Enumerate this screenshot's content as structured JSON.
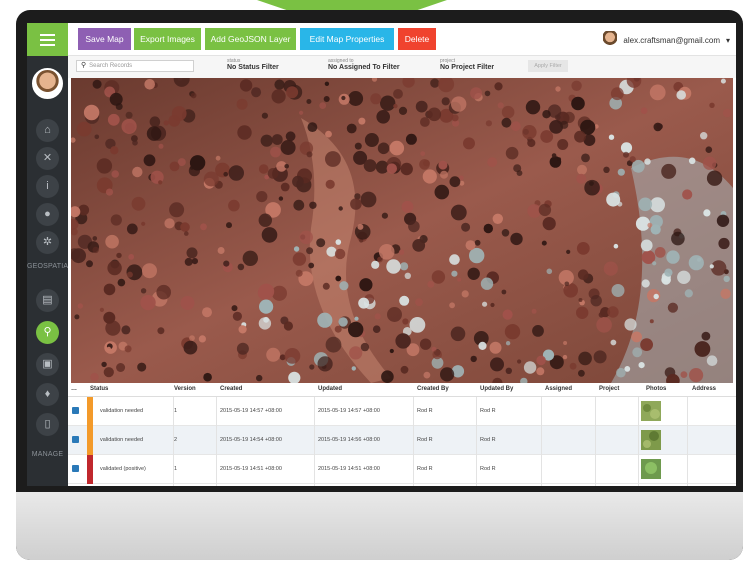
{
  "toolbar": {
    "buttons": [
      {
        "label": "Save Map",
        "color": "#8e5fb3"
      },
      {
        "label": "Export Images",
        "color": "#7ac143"
      },
      {
        "label": "Add GeoJSON Layer",
        "color": "#7ac143"
      },
      {
        "label": "Edit Map Properties",
        "color": "#29b6e8"
      },
      {
        "label": "Delete",
        "color": "#f0432e"
      }
    ],
    "user_email": "alex.craftsman@gmail.com"
  },
  "sidebar": {
    "section_geospatial": "GEOSPATIAL",
    "section_manage": "MANAGE",
    "icons": [
      "home-icon",
      "tools-icon",
      "info-icon",
      "tags-icon",
      "settings-icon",
      "document-icon",
      "map-pin-icon",
      "image-icon",
      "thumbs-up-icon",
      "file-icon"
    ]
  },
  "filters": {
    "search_placeholder": "Search Records",
    "status_label": "status",
    "status_value": "No Status Filter",
    "assigned_label": "assigned to",
    "assigned_value": "No Assigned To Filter",
    "project_label": "project",
    "project_value": "No Project Filter",
    "apply_label": "Apply Filter"
  },
  "table": {
    "columns": [
      "Status",
      "Version",
      "Created",
      "Updated",
      "Created By",
      "Updated By",
      "Assigned",
      "Project",
      "Photos",
      "Address"
    ],
    "rows": [
      {
        "status": "validation needed",
        "status_color": "#f39a2a",
        "version": "1",
        "created": "2015-05-19 14:57 +08:00",
        "updated": "2015-05-19 14:57 +08:00",
        "created_by": "Rod R",
        "updated_by": "Rod R"
      },
      {
        "status": "validation needed",
        "status_color": "#f39a2a",
        "version": "2",
        "created": "2015-05-19 14:54 +08:00",
        "updated": "2015-05-19 14:56 +08:00",
        "created_by": "Rod R",
        "updated_by": "Rod R"
      },
      {
        "status": "validated (positive)",
        "status_color": "#c0282d",
        "version": "1",
        "created": "2015-05-19 14:51 +08:00",
        "updated": "2015-05-19 14:51 +08:00",
        "created_by": "Rod R",
        "updated_by": "Rod R"
      }
    ]
  }
}
